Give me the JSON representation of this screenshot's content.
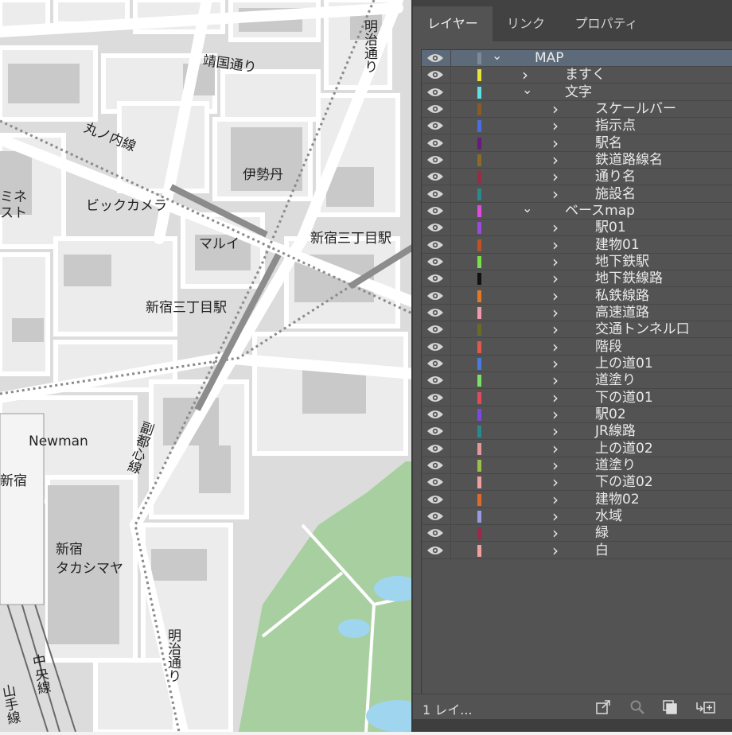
{
  "map": {
    "labels": {
      "yasukuni": "靖国通り",
      "meiji_top": "明治通り",
      "marunouchi": "丸ノ内線",
      "isetan": "伊勢丹",
      "lumine": "ミネ\nスト",
      "bic": "ビックカメラ",
      "marui": "マルイ",
      "station1": "新宿三丁目駅",
      "station2": "新宿三丁目駅",
      "newman": "Newman",
      "shinjuku": "新宿",
      "fukutoshin": "副都心線",
      "takashimaya1": "新宿",
      "takashimaya2": "タカシマヤ",
      "meiji_bottom": "明治通り",
      "chuo": "中央線",
      "yamanote": "山手線"
    },
    "colors": {
      "park": "#a8cfa0",
      "water": "#9fd5ef",
      "road": "#ffffff",
      "block": "#e6e6e6",
      "building": "#cfcfcf",
      "rail": "#8c8c8c"
    }
  },
  "panel": {
    "tabs": [
      "レイヤー",
      "リンク",
      "プロパティ"
    ],
    "active_tab": 0,
    "layers": [
      {
        "name": "MAP",
        "color": "#7d8a96",
        "level": 0,
        "expanded": true,
        "selected": true
      },
      {
        "name": "ますく",
        "color": "#e8e23a",
        "level": 1,
        "expanded": false
      },
      {
        "name": "文字",
        "color": "#5fe0e6",
        "level": 1,
        "expanded": true
      },
      {
        "name": "スケールバー",
        "color": "#8a5a2a",
        "level": 2,
        "expanded": false
      },
      {
        "name": "指示点",
        "color": "#4a6ee0",
        "level": 2,
        "expanded": false
      },
      {
        "name": "駅名",
        "color": "#6a1a7a",
        "level": 2,
        "expanded": false
      },
      {
        "name": "鉄道路線名",
        "color": "#8a6a2a",
        "level": 2,
        "expanded": false
      },
      {
        "name": "通り名",
        "color": "#9a2a4a",
        "level": 2,
        "expanded": false
      },
      {
        "name": "施設名",
        "color": "#2a8a8a",
        "level": 2,
        "expanded": false
      },
      {
        "name": "ベースmap",
        "color": "#e04ae0",
        "level": 1,
        "expanded": true
      },
      {
        "name": "駅01",
        "color": "#9a4ae0",
        "level": 2,
        "expanded": false
      },
      {
        "name": "建物01",
        "color": "#c0502a",
        "level": 2,
        "expanded": false
      },
      {
        "name": "地下鉄駅",
        "color": "#7ae04a",
        "level": 2,
        "expanded": false
      },
      {
        "name": "地下鉄線路",
        "color": "#111111",
        "level": 2,
        "expanded": false
      },
      {
        "name": "私鉄線路",
        "color": "#e07a2a",
        "level": 2,
        "expanded": false
      },
      {
        "name": "高速道路",
        "color": "#f09ab0",
        "level": 2,
        "expanded": false
      },
      {
        "name": "交通トンネル口",
        "color": "#6a6a2a",
        "level": 2,
        "expanded": false
      },
      {
        "name": "階段",
        "color": "#e05a4a",
        "level": 2,
        "expanded": false
      },
      {
        "name": "上の道01",
        "color": "#4a7ae0",
        "level": 2,
        "expanded": false
      },
      {
        "name": "道塗り",
        "color": "#7ae06a",
        "level": 2,
        "expanded": false
      },
      {
        "name": "下の道01",
        "color": "#e04a5a",
        "level": 2,
        "expanded": false
      },
      {
        "name": "駅02",
        "color": "#7a4ae0",
        "level": 2,
        "expanded": false
      },
      {
        "name": "JR線路",
        "color": "#2a8a8a",
        "level": 2,
        "expanded": false
      },
      {
        "name": "上の道02",
        "color": "#e09a9a",
        "level": 2,
        "expanded": false
      },
      {
        "name": "道塗り",
        "color": "#9ac04a",
        "level": 2,
        "expanded": false
      },
      {
        "name": "下の道02",
        "color": "#f0a0a0",
        "level": 2,
        "expanded": false
      },
      {
        "name": "建物02",
        "color": "#e06a2a",
        "level": 2,
        "expanded": false
      },
      {
        "name": "水域",
        "color": "#9a9ae0",
        "level": 2,
        "expanded": false
      },
      {
        "name": "緑",
        "color": "#9a2a4a",
        "level": 2,
        "expanded": false
      },
      {
        "name": "白",
        "color": "#f0a0a0",
        "level": 2,
        "expanded": false
      }
    ],
    "footer": {
      "count_text": "1 レイ...",
      "icons": [
        "export-icon",
        "search-icon",
        "clipping-mask-icon",
        "new-sublayer-icon"
      ]
    },
    "colors": {
      "panel_bg": "#535353",
      "tab_bg": "#424242",
      "selected_row": "#5c6a7a"
    }
  }
}
